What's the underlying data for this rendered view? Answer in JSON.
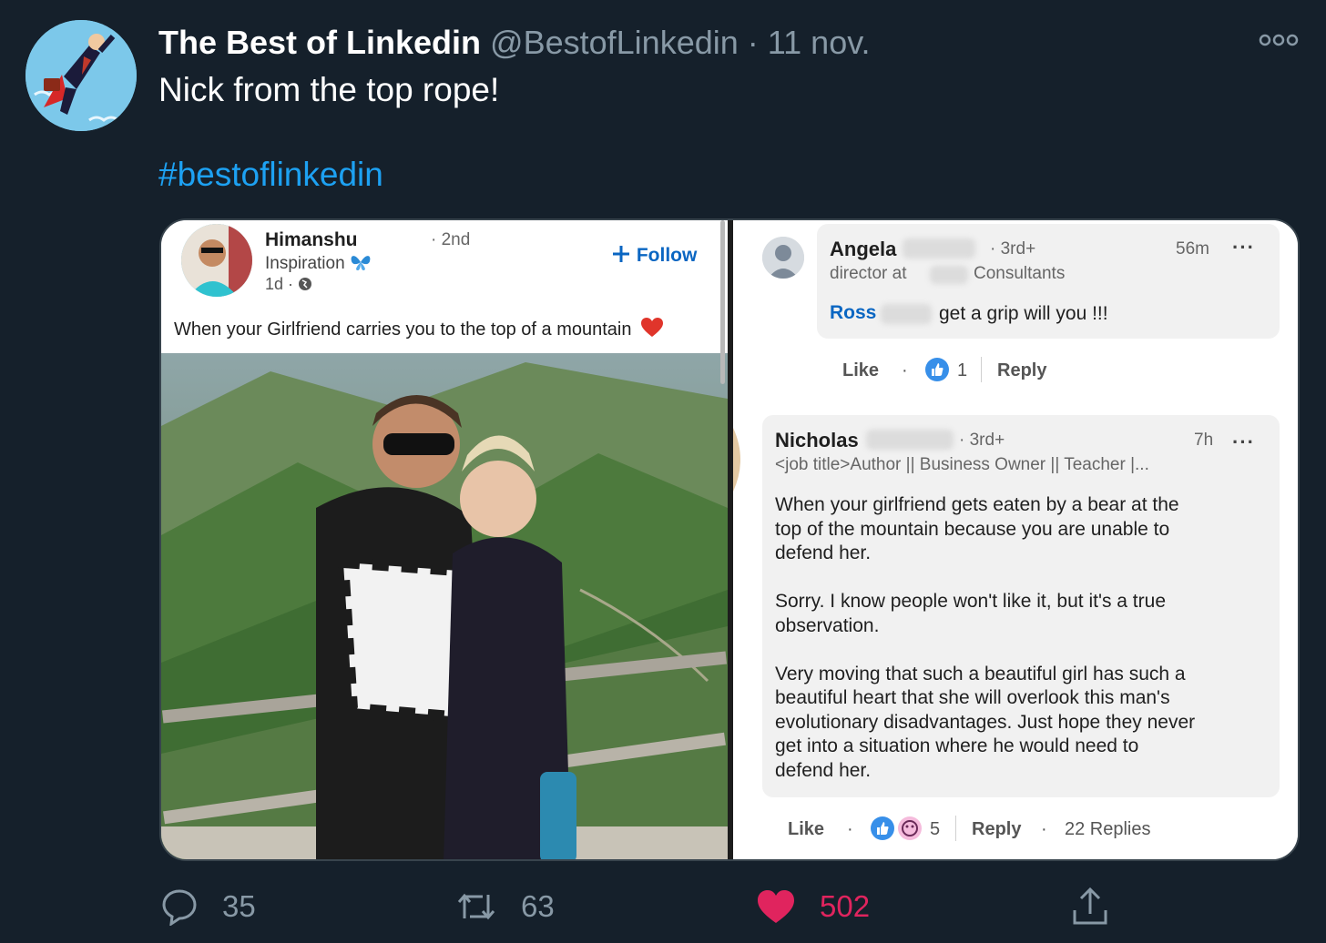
{
  "tweet": {
    "author_name": "The Best of Linkedin",
    "handle": "@BestofLinkedin",
    "separator": "·",
    "date": "11 nov.",
    "text": "Nick from the top rope!",
    "hashtag": "#bestoflinkedin"
  },
  "linkedin_post": {
    "author": "Himanshu",
    "degree": "· 2nd",
    "subtitle": "Inspiration",
    "time": "1d ·",
    "follow_label": "Follow",
    "text": "When your Girlfriend carries you to the top of a mountain"
  },
  "comment1": {
    "name": "Angela",
    "degree": "· 3rd+",
    "time": "56m",
    "headline_a": "director at",
    "headline_b": "Consultants",
    "mention": "Ross",
    "text": "get a grip will you !!!",
    "like_label": "Like",
    "dot": "·",
    "reaction_count": "1",
    "reply_label": "Reply"
  },
  "comment2": {
    "name": "Nicholas",
    "degree": "· 3rd+",
    "time": "7h",
    "headline": "<job title>Author || Business Owner || Teacher |...",
    "body": "When your girlfriend gets eaten by a bear at the\ntop of the mountain because you are unable to\ndefend her.\n\nSorry. I know people won't like it, but it's a true\nobservation.\n\nVery moving that such a beautiful girl has such a\nbeautiful heart that she will overlook this man's\nevolutionary disadvantages. Just hope they never\nget into a situation where he would need to\ndefend her.",
    "like_label": "Like",
    "dot": "·",
    "reaction_count": "5",
    "reply_label": "Reply",
    "replies_label": "22 Replies"
  },
  "actions": {
    "replies": "35",
    "retweets": "63",
    "likes": "502"
  },
  "colors": {
    "background": "#15202b",
    "muted": "#8899a6",
    "link": "#1da1f2",
    "like": "#e0245e",
    "linkedin_blue": "#0a66c2"
  }
}
